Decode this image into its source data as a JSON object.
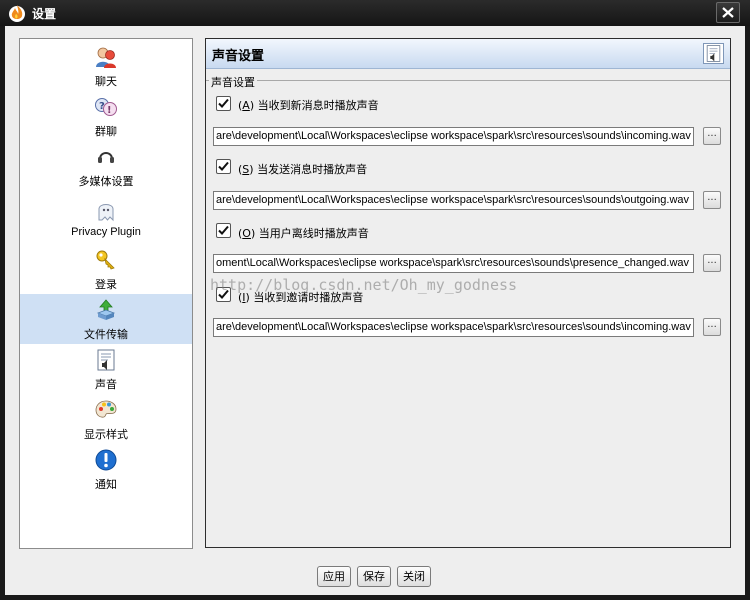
{
  "window": {
    "title": "设置",
    "icon": "spark-flame-icon",
    "close_icon": "close-x-icon"
  },
  "sidebar": {
    "items": [
      {
        "label": "聊天",
        "icon": "chat-users-icon",
        "selected": false
      },
      {
        "label": "群聊",
        "icon": "group-chat-icon",
        "selected": false
      },
      {
        "label": "多媒体设置",
        "icon": "headset-icon",
        "selected": false
      },
      {
        "label": "Privacy Plugin",
        "icon": "ghost-icon",
        "selected": false
      },
      {
        "label": "登录",
        "icon": "key-icon",
        "selected": false
      },
      {
        "label": "文件传输",
        "icon": "file-transfer-icon",
        "selected": true
      },
      {
        "label": "声音",
        "icon": "sound-doc-icon",
        "selected": false
      },
      {
        "label": "显示样式",
        "icon": "palette-icon",
        "selected": false
      },
      {
        "label": "通知",
        "icon": "alert-icon",
        "selected": false
      }
    ]
  },
  "panel": {
    "title": "声音设置",
    "icon": "sound-doc-icon",
    "group_label": "声音设置",
    "options": [
      {
        "mnemonic": "A",
        "label": "当收到新消息时播放声音",
        "checked": true,
        "path": "are\\development\\Local\\Workspaces\\eclipse workspace\\spark\\src\\resources\\sounds\\incoming.wav",
        "browse_label": "..."
      },
      {
        "mnemonic": "S",
        "label": "当发送消息时播放声音",
        "checked": true,
        "path": "are\\development\\Local\\Workspaces\\eclipse workspace\\spark\\src\\resources\\sounds\\outgoing.wav",
        "browse_label": "..."
      },
      {
        "mnemonic": "O",
        "label": "当用户离线时播放声音",
        "checked": true,
        "path": "oment\\Local\\Workspaces\\eclipse workspace\\spark\\src\\resources\\sounds\\presence_changed.wav",
        "browse_label": "..."
      },
      {
        "mnemonic": "I",
        "label": "当收到邀请时播放声音",
        "checked": true,
        "path": "are\\development\\Local\\Workspaces\\eclipse workspace\\spark\\src\\resources\\sounds\\incoming.wav",
        "browse_label": "..."
      }
    ]
  },
  "watermark": "http://blog.csdn.net/Oh_my_godness",
  "buttons": {
    "apply": "应用",
    "save": "保存",
    "close": "关闭"
  }
}
